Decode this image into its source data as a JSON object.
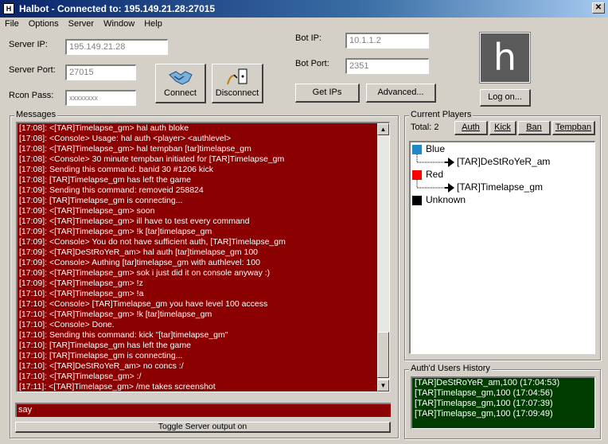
{
  "window": {
    "title": "Halbot - Connected to: 195.149.21.28:27015",
    "icon_text": "H",
    "close_label": "✕"
  },
  "menu": [
    "File",
    "Options",
    "Server",
    "Window",
    "Help"
  ],
  "connection": {
    "server_ip_label": "Server IP:",
    "server_ip": "195.149.21.28",
    "server_port_label": "Server Port:",
    "server_port": "27015",
    "rcon_label": "Rcon Pass:",
    "rcon": "xxxxxxxx",
    "connect_label": "Connect",
    "disconnect_label": "Disconnect"
  },
  "bot": {
    "ip_label": "Bot IP:",
    "ip": "10.1.1.2",
    "port_label": "Bot Port:",
    "port": "2351",
    "get_ips_label": "Get IPs",
    "advanced_label": "Advanced...",
    "logo_letter": "h",
    "logon_label": "Log on..."
  },
  "messages": {
    "title": "Messages",
    "lines": [
      "[17:08]: <[TAR]Timelapse_gm> hal auth bloke",
      "[17:08]: <Console> Usage: hal auth <player> <authlevel>",
      "[17:08]: <[TAR]Timelapse_gm> hal tempban [tar]timelapse_gm",
      "[17:08]: <Console> 30 minute tempban initiated for [TAR]Timelapse_gm",
      "[17:08]: Sending this command: banid 30 #1206 kick",
      "[17:08]: [TAR]Timelapse_gm has left the game",
      "[17:09]: Sending this command: removeid 258824",
      "[17:09]: [TAR]Timelapse_gm is connecting...",
      "[17:09]: <[TAR]Timelapse_gm> soon",
      "[17:09]: <[TAR]Timelapse_gm> ill have to test every command",
      "[17:09]: <[TAR]Timelapse_gm> !k [tar]timelapse_gm",
      "[17:09]: <Console> You do not have sufficient auth, [TAR]Timelapse_gm",
      "[17:09]: <[TAR]DeStRoYeR_am> hal auth [tar]timelapse_gm 100",
      "[17:09]: <Console> Authing [tar]timelapse_gm with authlevel: 100",
      "[17:09]: <[TAR]Timelapse_gm> sok i just did it on console anyway :)",
      "[17:09]: <[TAR]Timelapse_gm> !z",
      "[17:10]: <[TAR]Timelapse_gm> !a",
      "[17:10]: <Console> [TAR]Timelapse_gm you have level 100 access",
      "[17:10]: <[TAR]Timelapse_gm> !k [tar]timelapse_gm",
      "[17:10]: <Console> Done.",
      "[17:10]: Sending this command: kick \"[tar]timelapse_gm\"",
      "[17:10]: [TAR]Timelapse_gm has left the game",
      "[17:10]: [TAR]Timelapse_gm is connecting...",
      "[17:10]: <[TAR]DeStRoYeR_am> no concs :/",
      "[17:10]: <[TAR]Timelapse_gm> :/",
      "[17:11]: <[TAR]Timelapse_gm> /me takes screenshot"
    ],
    "input_value": "say",
    "toggle_label": "Toggle  Server output on"
  },
  "players": {
    "title": "Current Players",
    "total_label": "Total: 2",
    "buttons": [
      "Auth",
      "Kick",
      "Ban",
      "Tempban"
    ],
    "teams": [
      {
        "name": "Blue",
        "color": "#1e88c8",
        "players": [
          "[TAR]DeStRoYeR_am"
        ]
      },
      {
        "name": "Red",
        "color": "#ff0000",
        "players": [
          "[TAR]Timelapse_gm"
        ]
      },
      {
        "name": "Unknown",
        "color": "#000000",
        "players": []
      }
    ]
  },
  "history": {
    "title": "Auth'd Users History",
    "lines": [
      "[TAR]DeStRoYeR_am,100  (17:04:53)",
      "[TAR]Timelapse_gm,100  (17:04:56)",
      "[TAR]Timelapse_gm,100  (17:07:39)",
      "[TAR]Timelapse_gm,100  (17:09:49)"
    ]
  }
}
